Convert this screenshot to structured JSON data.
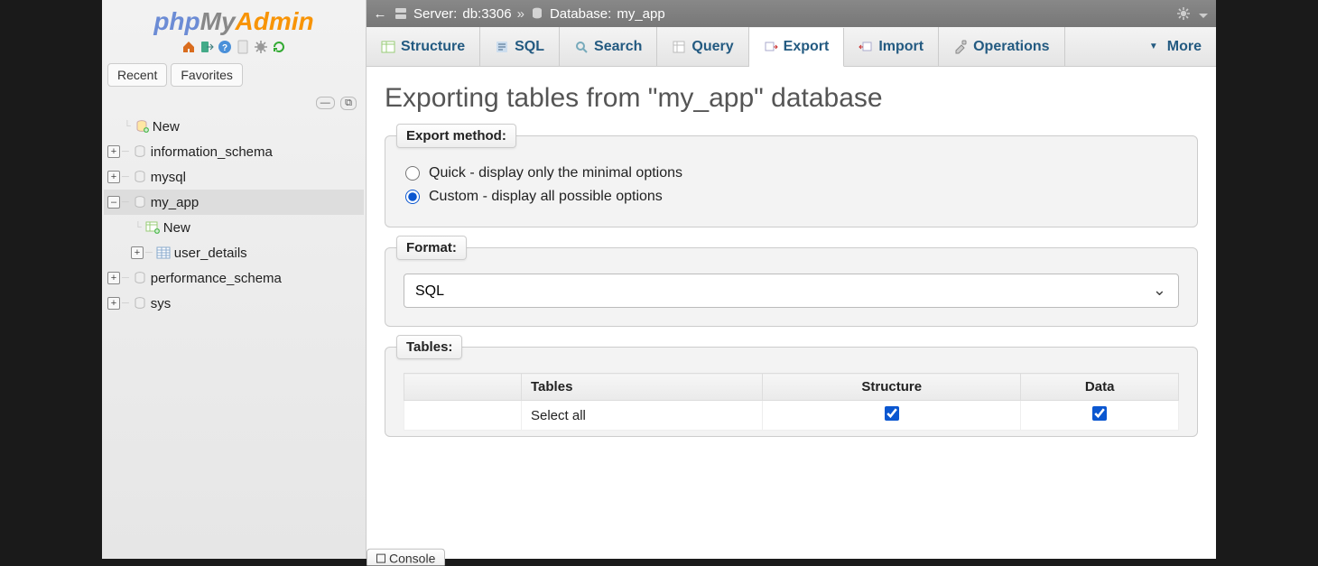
{
  "logo": {
    "a": "php",
    "b": "My",
    "c": "Admin"
  },
  "sidebar": {
    "tabs": {
      "recent": "Recent",
      "favorites": "Favorites"
    },
    "tree": {
      "new": "New",
      "items": [
        {
          "label": "information_schema"
        },
        {
          "label": "mysql"
        },
        {
          "label": "my_app",
          "expanded": true,
          "children": [
            {
              "label": "New",
              "new": true
            },
            {
              "label": "user_details",
              "icon": "table"
            }
          ]
        },
        {
          "label": "performance_schema"
        },
        {
          "label": "sys"
        }
      ]
    }
  },
  "breadcrumb": {
    "server_prefix": "Server: ",
    "server_value": "db:3306",
    "sep": "»",
    "db_prefix": "Database: ",
    "db_value": "my_app"
  },
  "nav": {
    "structure": "Structure",
    "sql": "SQL",
    "search": "Search",
    "query": "Query",
    "export": "Export",
    "import": "Import",
    "operations": "Operations",
    "more": "More"
  },
  "page": {
    "title": "Exporting tables from \"my_app\" database"
  },
  "export_method": {
    "legend": "Export method:",
    "quick": "Quick - display only the minimal options",
    "custom": "Custom - display all possible options",
    "selected": "custom"
  },
  "format": {
    "legend": "Format:",
    "selected": "SQL"
  },
  "tables": {
    "legend": "Tables:",
    "cols": {
      "name": "Tables",
      "structure": "Structure",
      "data": "Data"
    },
    "select_all": "Select all",
    "select_all_structure": true,
    "select_all_data": true
  },
  "console": {
    "label": "Console"
  }
}
